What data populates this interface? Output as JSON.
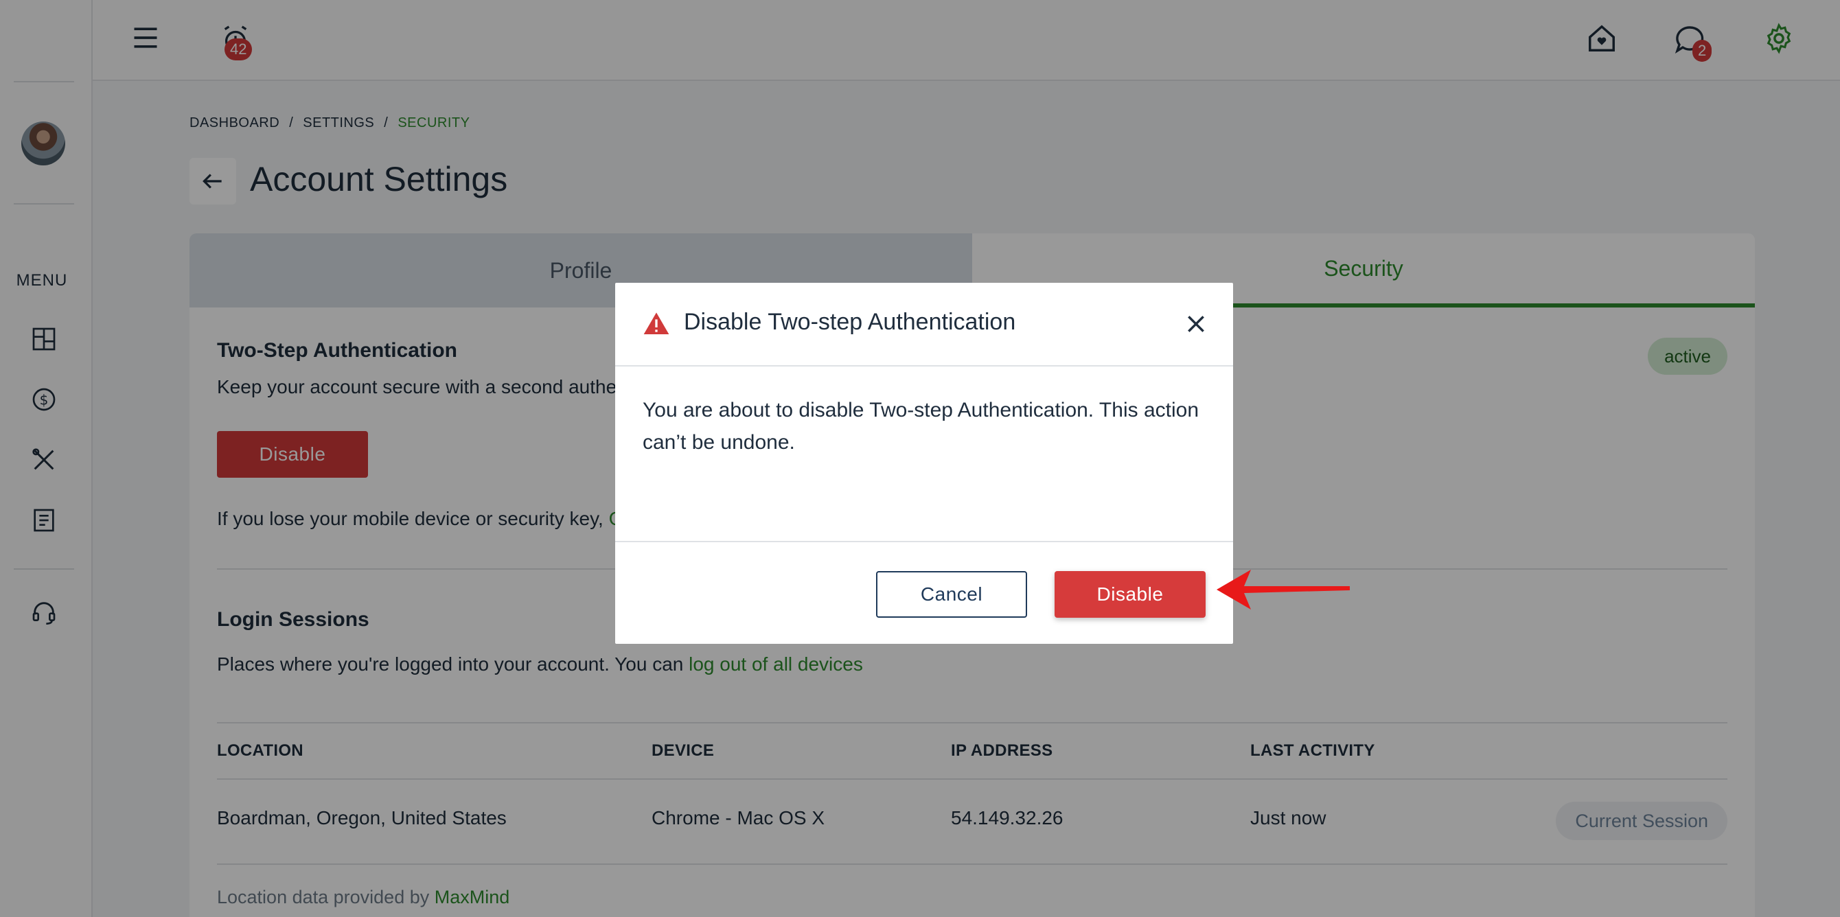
{
  "topbar": {
    "notifications_count": "42",
    "messages_count": "2"
  },
  "sidebar": {
    "menu_label": "MENU",
    "items": [
      {
        "icon": "dashboard-grid-icon"
      },
      {
        "icon": "dollar-coin-icon"
      },
      {
        "icon": "tools-icon"
      },
      {
        "icon": "document-icon"
      },
      {
        "icon": "headset-support-icon"
      }
    ]
  },
  "breadcrumb": {
    "items": [
      "DASHBOARD",
      "SETTINGS",
      "SECURITY"
    ],
    "separator": "/"
  },
  "page": {
    "title": "Account Settings"
  },
  "tabs": [
    {
      "label": "Profile",
      "active": false
    },
    {
      "label": "Security",
      "active": true
    }
  ],
  "two_step": {
    "title": "Two-Step Authentication",
    "description": "Keep your account secure with a second authen",
    "status": "active",
    "disable_label": "Disable",
    "recovery_text_prefix": "If you lose your mobile device or security key,",
    "recovery_link_fragment": "G"
  },
  "login_sessions": {
    "title": "Login Sessions",
    "description_prefix": "Places where you're logged into your account. You can",
    "logout_link": "log out of all devices",
    "columns": [
      "LOCATION",
      "DEVICE",
      "IP ADDRESS",
      "LAST ACTIVITY"
    ],
    "rows": [
      {
        "location": "Boardman, Oregon, United States",
        "device": "Chrome - Mac OS X",
        "ip": "54.149.32.26",
        "last_activity": "Just now",
        "badge": "Current Session"
      }
    ],
    "footer_prefix": "Location data provided by",
    "footer_link": "MaxMind"
  },
  "modal": {
    "title": "Disable Two-step Authentication",
    "body": "You are about to disable Two-step Authentication. This action can’t be undone.",
    "cancel_label": "Cancel",
    "confirm_label": "Disable"
  },
  "colors": {
    "accent_green": "#2d8a2d",
    "danger_red": "#d03a3a",
    "navy": "#1f3a5a"
  }
}
